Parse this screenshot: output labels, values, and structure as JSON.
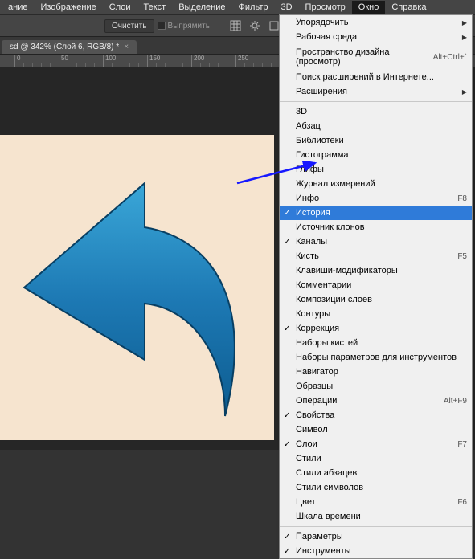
{
  "menubar": {
    "items": [
      "ание",
      "Изображение",
      "Слои",
      "Текст",
      "Выделение",
      "Фильтр",
      "3D",
      "Просмотр",
      "Окно",
      "Справка"
    ],
    "open_index": 8
  },
  "toolbar": {
    "clear_label": "Очистить",
    "align_label": "Выпрямить"
  },
  "tab": {
    "title": "sd @ 342% (Слой 6, RGB/8) *"
  },
  "ruler": {
    "ticks": [
      "0",
      "50",
      "100",
      "150",
      "200",
      "250"
    ]
  },
  "window_menu": {
    "groups": [
      [
        {
          "label": "Упорядочить",
          "sub": true
        },
        {
          "label": "Рабочая среда",
          "sub": true
        }
      ],
      [
        {
          "label": "Пространство дизайна (просмотр)",
          "shortcut": "Alt+Ctrl+`"
        }
      ],
      [
        {
          "label": "Поиск расширений в Интернете..."
        },
        {
          "label": "Расширения",
          "sub": true
        }
      ],
      [
        {
          "label": "3D"
        },
        {
          "label": "Абзац"
        },
        {
          "label": "Библиотеки"
        },
        {
          "label": "Гистограмма"
        },
        {
          "label": "Глифы"
        },
        {
          "label": "Журнал измерений"
        },
        {
          "label": "Инфо",
          "shortcut": "F8"
        },
        {
          "label": "История",
          "checked": true,
          "highlight": true
        },
        {
          "label": "Источник клонов"
        },
        {
          "label": "Каналы",
          "checked": true
        },
        {
          "label": "Кисть",
          "shortcut": "F5"
        },
        {
          "label": "Клавиши-модификаторы"
        },
        {
          "label": "Комментарии"
        },
        {
          "label": "Композиции слоев"
        },
        {
          "label": "Контуры"
        },
        {
          "label": "Коррекция",
          "checked": true
        },
        {
          "label": "Наборы кистей"
        },
        {
          "label": "Наборы параметров для инструментов"
        },
        {
          "label": "Навигатор"
        },
        {
          "label": "Образцы"
        },
        {
          "label": "Операции",
          "shortcut": "Alt+F9"
        },
        {
          "label": "Свойства",
          "checked": true
        },
        {
          "label": "Символ"
        },
        {
          "label": "Слои",
          "checked": true,
          "shortcut": "F7"
        },
        {
          "label": "Стили"
        },
        {
          "label": "Стили абзацев"
        },
        {
          "label": "Стили символов"
        },
        {
          "label": "Цвет",
          "shortcut": "F6"
        },
        {
          "label": "Шкала времени"
        }
      ],
      [
        {
          "label": "Параметры",
          "checked": true
        },
        {
          "label": "Инструменты",
          "checked": true
        }
      ]
    ]
  }
}
